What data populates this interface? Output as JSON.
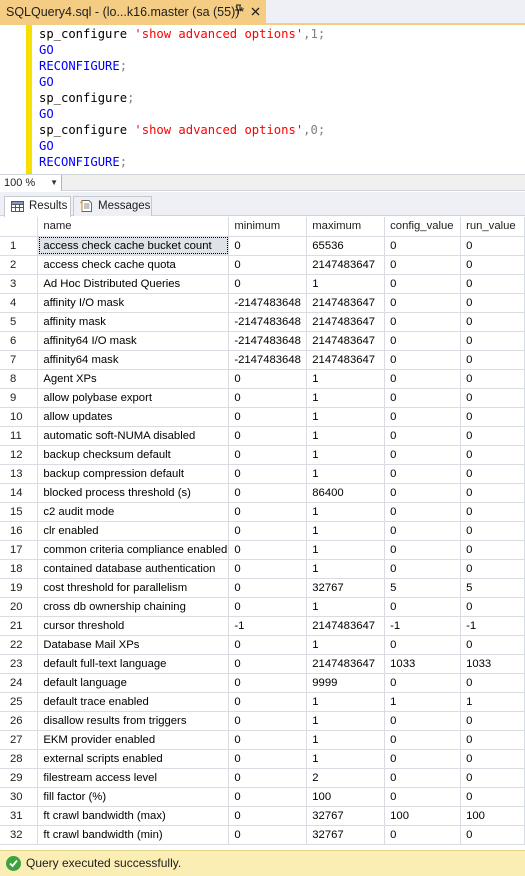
{
  "tab": {
    "title": "SQLQuery4.sql - (lo...k16.master (sa (55))*",
    "pin_icon": "pin-icon",
    "close_icon": "close-icon"
  },
  "editor": {
    "lines": [
      {
        "parts": [
          {
            "text": "sp_configure ",
            "kind": "kw-black"
          },
          {
            "text": "'show advanced options'",
            "kind": "kw-str"
          },
          {
            "text": ",1;",
            "kind": "kw-gray"
          }
        ]
      },
      {
        "parts": [
          {
            "text": "GO",
            "kind": "kw-blue"
          }
        ]
      },
      {
        "parts": [
          {
            "text": "RECONFIGURE",
            "kind": "kw-blue"
          },
          {
            "text": ";",
            "kind": "kw-gray"
          }
        ]
      },
      {
        "parts": [
          {
            "text": "GO",
            "kind": "kw-blue"
          }
        ]
      },
      {
        "parts": [
          {
            "text": "sp_configure",
            "kind": "kw-black"
          },
          {
            "text": ";",
            "kind": "kw-gray"
          }
        ]
      },
      {
        "parts": [
          {
            "text": "GO",
            "kind": "kw-blue"
          }
        ]
      },
      {
        "parts": [
          {
            "text": "sp_configure ",
            "kind": "kw-black"
          },
          {
            "text": "'show advanced options'",
            "kind": "kw-str"
          },
          {
            "text": ",0;",
            "kind": "kw-gray"
          }
        ]
      },
      {
        "parts": [
          {
            "text": "GO",
            "kind": "kw-blue"
          }
        ]
      },
      {
        "parts": [
          {
            "text": "RECONFIGURE",
            "kind": "kw-blue"
          },
          {
            "text": ";",
            "kind": "kw-gray"
          }
        ]
      }
    ]
  },
  "zoom": {
    "value": "100 %"
  },
  "result_tabs": [
    {
      "label": "Results",
      "icon": "grid-icon",
      "active": true
    },
    {
      "label": "Messages",
      "icon": "messages-icon",
      "active": false
    }
  ],
  "grid": {
    "columns": [
      "name",
      "minimum",
      "maximum",
      "config_value",
      "run_value"
    ],
    "rows": [
      [
        "1",
        "access check cache bucket count",
        "0",
        "65536",
        "0",
        "0"
      ],
      [
        "2",
        "access check cache quota",
        "0",
        "2147483647",
        "0",
        "0"
      ],
      [
        "3",
        "Ad Hoc Distributed Queries",
        "0",
        "1",
        "0",
        "0"
      ],
      [
        "4",
        "affinity I/O mask",
        "-2147483648",
        "2147483647",
        "0",
        "0"
      ],
      [
        "5",
        "affinity mask",
        "-2147483648",
        "2147483647",
        "0",
        "0"
      ],
      [
        "6",
        "affinity64 I/O mask",
        "-2147483648",
        "2147483647",
        "0",
        "0"
      ],
      [
        "7",
        "affinity64 mask",
        "-2147483648",
        "2147483647",
        "0",
        "0"
      ],
      [
        "8",
        "Agent XPs",
        "0",
        "1",
        "0",
        "0"
      ],
      [
        "9",
        "allow polybase export",
        "0",
        "1",
        "0",
        "0"
      ],
      [
        "10",
        "allow updates",
        "0",
        "1",
        "0",
        "0"
      ],
      [
        "11",
        "automatic soft-NUMA disabled",
        "0",
        "1",
        "0",
        "0"
      ],
      [
        "12",
        "backup checksum default",
        "0",
        "1",
        "0",
        "0"
      ],
      [
        "13",
        "backup compression default",
        "0",
        "1",
        "0",
        "0"
      ],
      [
        "14",
        "blocked process threshold (s)",
        "0",
        "86400",
        "0",
        "0"
      ],
      [
        "15",
        "c2 audit mode",
        "0",
        "1",
        "0",
        "0"
      ],
      [
        "16",
        "clr enabled",
        "0",
        "1",
        "0",
        "0"
      ],
      [
        "17",
        "common criteria compliance enabled",
        "0",
        "1",
        "0",
        "0"
      ],
      [
        "18",
        "contained database authentication",
        "0",
        "1",
        "0",
        "0"
      ],
      [
        "19",
        "cost threshold for parallelism",
        "0",
        "32767",
        "5",
        "5"
      ],
      [
        "20",
        "cross db ownership chaining",
        "0",
        "1",
        "0",
        "0"
      ],
      [
        "21",
        "cursor threshold",
        "-1",
        "2147483647",
        "-1",
        "-1"
      ],
      [
        "22",
        "Database Mail XPs",
        "0",
        "1",
        "0",
        "0"
      ],
      [
        "23",
        "default full-text language",
        "0",
        "2147483647",
        "1033",
        "1033"
      ],
      [
        "24",
        "default language",
        "0",
        "9999",
        "0",
        "0"
      ],
      [
        "25",
        "default trace enabled",
        "0",
        "1",
        "1",
        "1"
      ],
      [
        "26",
        "disallow results from triggers",
        "0",
        "1",
        "0",
        "0"
      ],
      [
        "27",
        "EKM provider enabled",
        "0",
        "1",
        "0",
        "0"
      ],
      [
        "28",
        "external scripts enabled",
        "0",
        "1",
        "0",
        "0"
      ],
      [
        "29",
        "filestream access level",
        "0",
        "2",
        "0",
        "0"
      ],
      [
        "30",
        "fill factor (%)",
        "0",
        "100",
        "0",
        "0"
      ],
      [
        "31",
        "ft crawl bandwidth (max)",
        "0",
        "32767",
        "100",
        "100"
      ],
      [
        "32",
        "ft crawl bandwidth (min)",
        "0",
        "32767",
        "0",
        "0"
      ]
    ]
  },
  "status": {
    "text": "Query executed successfully.",
    "icon": "success-check-icon"
  },
  "colors": {
    "tab_accent": "#f5cc84",
    "status_bar": "#fbeeb5",
    "change_bar": "#f7e000",
    "keyword": "#0000ff",
    "string": "#ff0000"
  }
}
